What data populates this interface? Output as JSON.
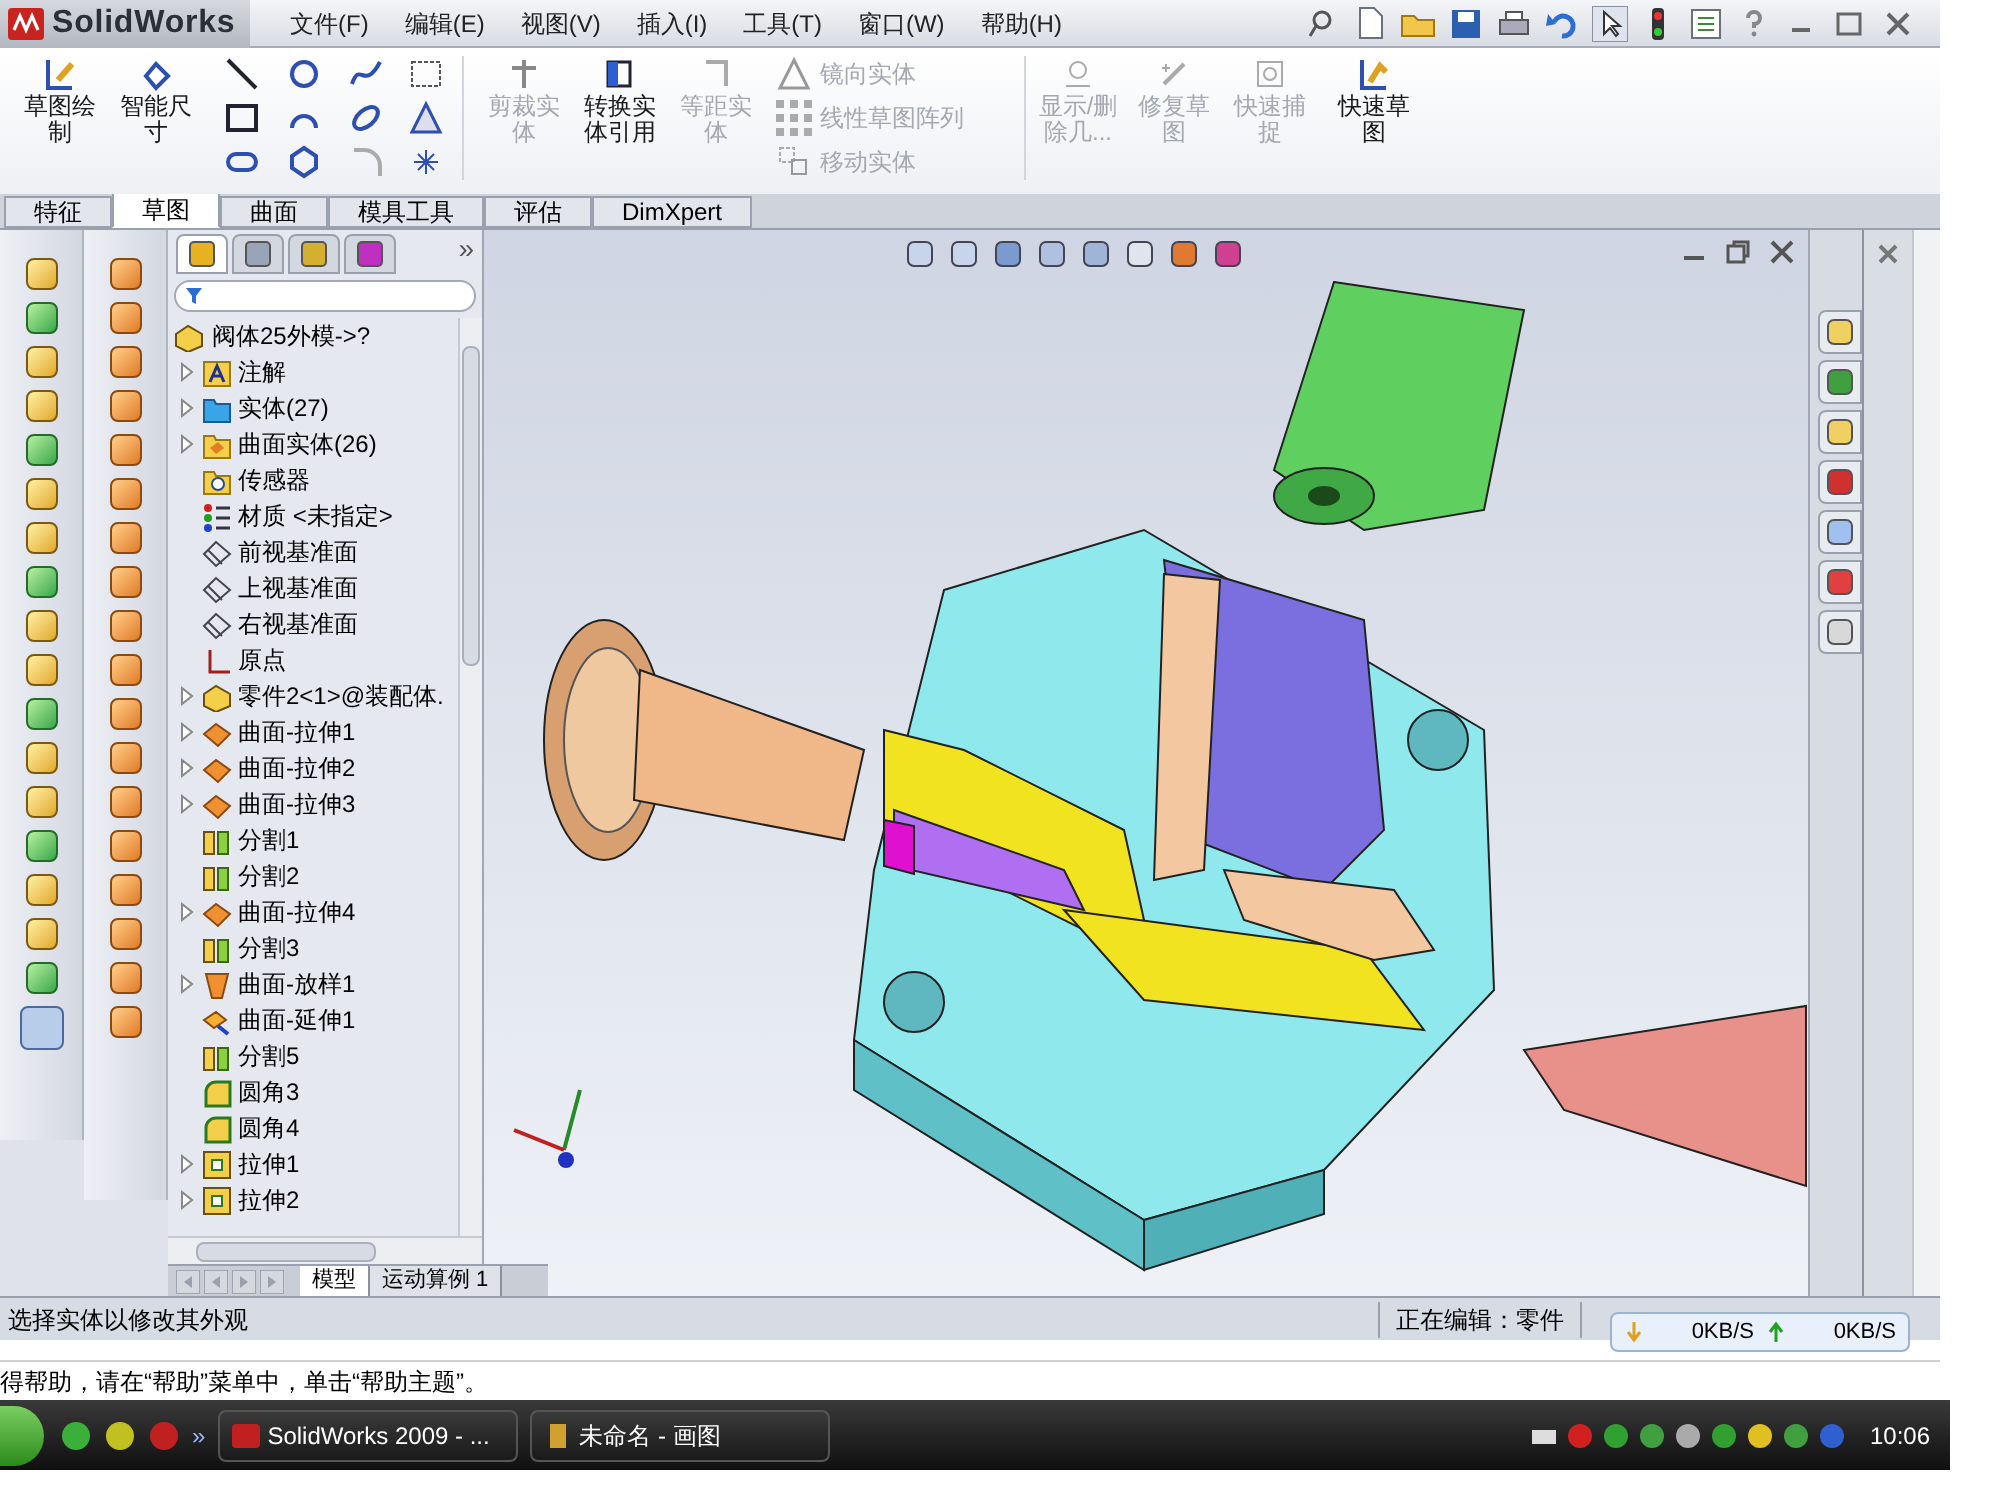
{
  "app": {
    "logo": "SolidWorks"
  },
  "menu": [
    "文件(F)",
    "编辑(E)",
    "视图(V)",
    "插入(I)",
    "工具(T)",
    "窗口(W)",
    "帮助(H)"
  ],
  "ribbon": [
    {
      "label": "草图绘制",
      "kind": "large",
      "disabled": false
    },
    {
      "label": "智能尺寸",
      "kind": "large",
      "disabled": false
    },
    {
      "label": "剪裁实体",
      "kind": "large",
      "disabled": true
    },
    {
      "label": "转换实体引用",
      "kind": "large",
      "disabled": false
    },
    {
      "label": "等距实体",
      "kind": "large",
      "disabled": true
    },
    {
      "label": "镜向实体",
      "kind": "small",
      "disabled": true
    },
    {
      "label": "线性草图阵列",
      "kind": "small",
      "disabled": true
    },
    {
      "label": "移动实体",
      "kind": "small",
      "disabled": true
    },
    {
      "label": "显示/删除几...",
      "kind": "large",
      "disabled": true
    },
    {
      "label": "修复草图",
      "kind": "large",
      "disabled": true
    },
    {
      "label": "快速捕捉",
      "kind": "large",
      "disabled": true
    },
    {
      "label": "快速草图",
      "kind": "large",
      "disabled": false
    }
  ],
  "feature_tabs": [
    {
      "label": "特征",
      "selected": false
    },
    {
      "label": "草图",
      "selected": true
    },
    {
      "label": "曲面",
      "selected": false
    },
    {
      "label": "模具工具",
      "selected": false
    },
    {
      "label": "评估",
      "selected": false
    },
    {
      "label": "DimXpert",
      "selected": false
    }
  ],
  "tree": {
    "panel_tabs": [
      {
        "selected": true
      },
      {
        "selected": false
      },
      {
        "selected": false
      },
      {
        "selected": false
      }
    ],
    "overflow": "»",
    "root": "阀体25外模->?",
    "items": [
      {
        "label": "注解",
        "kind": "annotation",
        "expandable": true
      },
      {
        "label": "实体(27)",
        "kind": "solid",
        "expandable": true
      },
      {
        "label": "曲面实体(26)",
        "kind": "surfaces",
        "expandable": true
      },
      {
        "label": "传感器",
        "kind": "sensor",
        "expandable": false
      },
      {
        "label": "材质 <未指定>",
        "kind": "material",
        "expandable": false
      },
      {
        "label": "前视基准面",
        "kind": "plane",
        "expandable": false
      },
      {
        "label": "上视基准面",
        "kind": "plane",
        "expandable": false
      },
      {
        "label": "右视基准面",
        "kind": "plane",
        "expandable": false
      },
      {
        "label": "原点",
        "kind": "origin",
        "expandable": false
      },
      {
        "label": "零件2<1>@装配体.",
        "kind": "part",
        "expandable": true
      },
      {
        "label": "曲面-拉伸1",
        "kind": "surface",
        "expandable": true
      },
      {
        "label": "曲面-拉伸2",
        "kind": "surface",
        "expandable": true
      },
      {
        "label": "曲面-拉伸3",
        "kind": "surface",
        "expandable": true
      },
      {
        "label": "分割1",
        "kind": "split",
        "expandable": false
      },
      {
        "label": "分割2",
        "kind": "split",
        "expandable": false
      },
      {
        "label": "曲面-拉伸4",
        "kind": "surface",
        "expandable": true
      },
      {
        "label": "分割3",
        "kind": "split",
        "expandable": false
      },
      {
        "label": "曲面-放样1",
        "kind": "loft",
        "expandable": true
      },
      {
        "label": "曲面-延伸1",
        "kind": "extend",
        "expandable": false
      },
      {
        "label": "分割5",
        "kind": "split",
        "expandable": false
      },
      {
        "label": "圆角3",
        "kind": "fillet",
        "expandable": false
      },
      {
        "label": "圆角4",
        "kind": "fillet",
        "expandable": false
      },
      {
        "label": "拉伸1",
        "kind": "extrude",
        "expandable": true
      },
      {
        "label": "拉伸2",
        "kind": "extrude",
        "expandable": true
      }
    ]
  },
  "bottom_tabs": [
    {
      "label": "模型",
      "selected": true
    },
    {
      "label": "运动算例 1",
      "selected": false
    }
  ],
  "status_bar": {
    "hint": "选择实体以修改其外观",
    "mode": "正在编辑：零件"
  },
  "network": {
    "down": "0KB/S",
    "up": "0KB/S"
  },
  "help_line": "得帮助，请在“帮助”菜单中，单击“帮助主题”。",
  "taskbar": {
    "overflow": "»",
    "tasks": [
      "SolidWorks 2009 - ...",
      "未命名 - 画图"
    ],
    "clock": "10:06"
  }
}
